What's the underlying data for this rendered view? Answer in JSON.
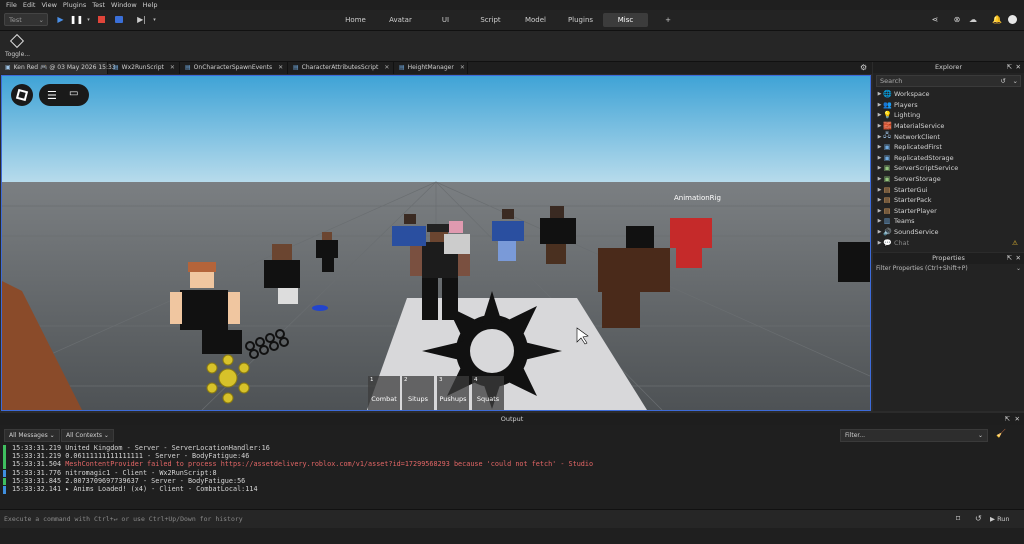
{
  "menubar": {
    "items": [
      "File",
      "Edit",
      "View",
      "Plugins",
      "Test",
      "Window",
      "Help"
    ]
  },
  "toolbar": {
    "mode_select": "Test",
    "tabs": [
      "Home",
      "Avatar",
      "UI",
      "Script",
      "Model",
      "Plugins",
      "Misc"
    ],
    "active_tab": "Misc",
    "add_tab": "+"
  },
  "ribbon": {
    "toggle_label": "Toggle..."
  },
  "doc_tabs": [
    {
      "label": "Ken Red 🎮 @ 03 May 2026 15:33"
    },
    {
      "label": "Wx2RunScript"
    },
    {
      "label": "OnCharacterSpawnEvents"
    },
    {
      "label": "CharacterAttributesScript"
    },
    {
      "label": "HeightManager"
    }
  ],
  "viewport": {
    "rig_label": "AnimationRig",
    "hotbar": [
      {
        "num": "1",
        "label": "Combat"
      },
      {
        "num": "2",
        "label": "Situps"
      },
      {
        "num": "3",
        "label": "Pushups"
      },
      {
        "num": "4",
        "label": "Squats"
      }
    ]
  },
  "explorer": {
    "title": "Explorer",
    "search_placeholder": "Search",
    "items": [
      {
        "label": "Workspace",
        "icon": "🌐",
        "color": "#6fa8dc"
      },
      {
        "label": "Players",
        "icon": "👥",
        "color": "#6fa8dc"
      },
      {
        "label": "Lighting",
        "icon": "💡",
        "color": "#f1c232"
      },
      {
        "label": "MaterialService",
        "icon": "🧱",
        "color": "#c27ba0"
      },
      {
        "label": "NetworkClient",
        "icon": "🖧",
        "color": "#9fc5e8"
      },
      {
        "label": "ReplicatedFirst",
        "icon": "▣",
        "color": "#6fa8dc"
      },
      {
        "label": "ReplicatedStorage",
        "icon": "▣",
        "color": "#6fa8dc"
      },
      {
        "label": "ServerScriptService",
        "icon": "▣",
        "color": "#93c47d"
      },
      {
        "label": "ServerStorage",
        "icon": "▣",
        "color": "#93c47d"
      },
      {
        "label": "StarterGui",
        "icon": "▤",
        "color": "#f6b26b"
      },
      {
        "label": "StarterPack",
        "icon": "▤",
        "color": "#f6b26b"
      },
      {
        "label": "StarterPlayer",
        "icon": "▤",
        "color": "#f6b26b"
      },
      {
        "label": "Teams",
        "icon": "▥",
        "color": "#6fa8dc"
      },
      {
        "label": "SoundService",
        "icon": "🔊",
        "color": "#6fa8dc"
      },
      {
        "label": "Chat",
        "icon": "💬",
        "color": "#888888"
      }
    ]
  },
  "properties": {
    "title": "Properties",
    "filter_placeholder": "Filter Properties (Ctrl+Shift+P)"
  },
  "output": {
    "title": "Output",
    "messages_filter": "All Messages ⌄",
    "contexts_filter": "All Contexts ⌄",
    "filter_placeholder": "Filter...",
    "lines": [
      {
        "time": "15:33:31.219",
        "text": "United Kingdom  -  Server - ServerLocationHandler:16",
        "color": "#d4d4d4",
        "bar": "#3fbf5f"
      },
      {
        "time": "15:33:31.219",
        "text": "0.06111111111111111  -  Server - BodyFatigue:46",
        "color": "#d4d4d4",
        "bar": "#3fbf5f"
      },
      {
        "time": "15:33:31.504",
        "text": "MeshContentProvider failed to process https://assetdelivery.roblox.com/v1/asset?id=17299568293 because 'could not fetch'  -  Studio",
        "color": "#e36666",
        "bar": "#3fbf5f"
      },
      {
        "time": "15:33:31.776",
        "text": "nitromagic1  -  Client - Wx2RunScript:8",
        "color": "#d4d4d4",
        "bar": "#3f8fdf"
      },
      {
        "time": "15:33:31.845",
        "text": "2.0073709697739637  -  Server - BodyFatigue:56",
        "color": "#d4d4d4",
        "bar": "#3fbf5f"
      },
      {
        "time": "15:33:32.141",
        "text": " ▸ Anims Loaded! (x4)  -  Client - CombatLocal:114",
        "color": "#d4d4d4",
        "bar": "#3f8fdf"
      }
    ]
  },
  "command": {
    "placeholder": "Execute a command with Ctrl+↵ or use Ctrl+Up/Down for history",
    "run_label": "Run"
  }
}
